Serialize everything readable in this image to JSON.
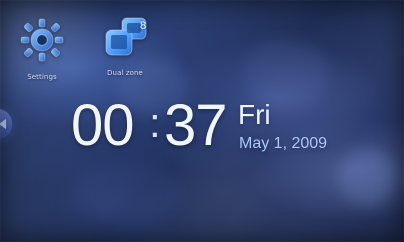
{
  "apps": {
    "settings": {
      "label": "Settings",
      "icon": "gear-icon",
      "accent": "#6fa8ff"
    },
    "dual_zone": {
      "label": "Dual zone",
      "icon": "dual-screen-icon",
      "badge": "8",
      "accent": "#4e9dff"
    }
  },
  "clock": {
    "hours": "00",
    "separator": ":",
    "minutes": "37"
  },
  "date": {
    "weekday": "Fri",
    "full": "May 1, 2009"
  },
  "nav": {
    "left_icon": "left-arrow-icon"
  }
}
